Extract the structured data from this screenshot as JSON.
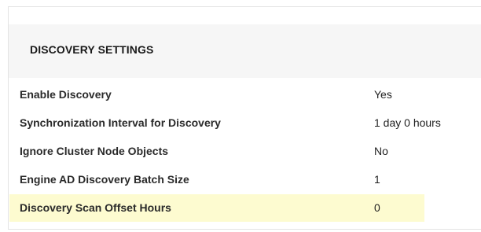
{
  "section": {
    "title": "DISCOVERY SETTINGS"
  },
  "settings": [
    {
      "label": "Enable Discovery",
      "value": "Yes",
      "highlighted": false
    },
    {
      "label": "Synchronization Interval for Discovery",
      "value": "1 day 0 hours",
      "highlighted": false
    },
    {
      "label": "Ignore Cluster Node Objects",
      "value": "No",
      "highlighted": false
    },
    {
      "label": "Engine AD Discovery Batch Size",
      "value": "1",
      "highlighted": false
    },
    {
      "label": "Discovery Scan Offset Hours",
      "value": "0",
      "highlighted": true
    }
  ],
  "colors": {
    "highlight": "#fdfbd0",
    "header_background": "#f6f6f6"
  }
}
